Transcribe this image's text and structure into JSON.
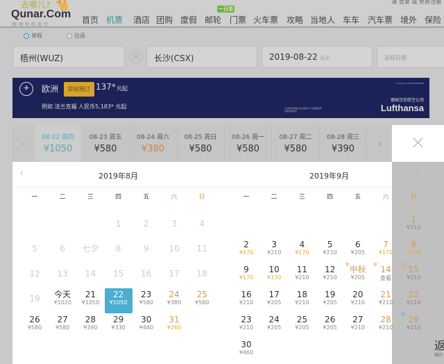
{
  "header": {
    "logo_cn": "去哪儿?",
    "logo": "Qunar.Com",
    "slogan": "聪明你的旅行",
    "top_links": "请 登录 或 免费注册",
    "nav": [
      "首页",
      "机票",
      "酒店",
      "团购",
      "度假",
      "邮轮",
      "门票",
      "火车票",
      "攻略",
      "当地人",
      "车车",
      "汽车票",
      "境外",
      "保险"
    ],
    "nav_active": 1,
    "nav_badge": "一日游"
  },
  "search": {
    "trip_types": [
      "单程",
      "往返"
    ],
    "from": "梧州(WUZ)",
    "swap": "换",
    "to": "长沙(CSX)",
    "date": "2019-08-22",
    "date_hint": "后天",
    "return_placeholder": "返程日期"
  },
  "banner": {
    "region": "欧洲",
    "book_label": "即刻预订",
    "price": "137*",
    "unit": "元起",
    "example": "例如 法兰克福 人民币5,183* 元起",
    "fine_print": "*包括所有税费及附加费用 不包括服务费和票务服务费",
    "alliance": "A STAR ALLIANCE MEMBER",
    "airline_cn": "德国汉莎航空公司",
    "airline": "Lufthansa"
  },
  "date_strip": [
    {
      "d": "08-22 周四",
      "p": "¥1050",
      "state": "active"
    },
    {
      "d": "08-23 周五",
      "p": "¥580"
    },
    {
      "d": "08-24 周六",
      "p": "¥380",
      "state": "low"
    },
    {
      "d": "08-25 周日",
      "p": "¥580"
    },
    {
      "d": "08-26 周一",
      "p": "¥580"
    },
    {
      "d": "08-27 周二",
      "p": "¥580"
    },
    {
      "d": "08-28 周三",
      "p": "¥390"
    }
  ],
  "weekdays": [
    "一",
    "二",
    "三",
    "四",
    "五",
    "六",
    "日"
  ],
  "calendar": [
    {
      "title": "2019年8月",
      "weeks": [
        [
          null,
          null,
          null,
          {
            "n": "1",
            "past": 1
          },
          {
            "n": "2",
            "past": 1
          },
          {
            "n": "3",
            "past": 1
          },
          {
            "n": "4",
            "past": 1
          }
        ],
        [
          {
            "n": "5",
            "past": 1
          },
          {
            "n": "6",
            "past": 1
          },
          {
            "n": "七夕",
            "past": 1
          },
          {
            "n": "8",
            "past": 1
          },
          {
            "n": "9",
            "past": 1
          },
          {
            "n": "10",
            "past": 1
          },
          {
            "n": "11",
            "past": 1
          }
        ],
        [
          {
            "n": "12",
            "past": 1
          },
          {
            "n": "13",
            "past": 1
          },
          {
            "n": "14",
            "past": 1
          },
          {
            "n": "15",
            "past": 1
          },
          {
            "n": "16",
            "past": 1
          },
          {
            "n": "17",
            "past": 1
          },
          {
            "n": "18",
            "past": 1
          }
        ],
        [
          {
            "n": "19",
            "past": 1
          },
          {
            "n": "今天",
            "p": "¥1020"
          },
          {
            "n": "21",
            "p": "¥1050"
          },
          {
            "n": "22",
            "p": "¥1050",
            "sel": 1
          },
          {
            "n": "23",
            "p": "¥580"
          },
          {
            "n": "24",
            "p": "¥380"
          },
          {
            "n": "25",
            "p": "¥580"
          }
        ],
        [
          {
            "n": "26",
            "p": "¥580"
          },
          {
            "n": "27",
            "p": "¥580"
          },
          {
            "n": "28",
            "p": "¥390"
          },
          {
            "n": "29",
            "p": "¥330"
          },
          {
            "n": "30",
            "p": "¥440"
          },
          {
            "n": "31",
            "p": "¥260",
            "low": 1
          },
          null
        ]
      ]
    },
    {
      "title": "2019年9月",
      "weeks": [
        [
          null,
          null,
          null,
          null,
          null,
          null,
          {
            "n": "1",
            "p": "¥210"
          }
        ],
        [
          {
            "n": "2",
            "p": "¥170",
            "low": 1
          },
          {
            "n": "3",
            "p": "¥210"
          },
          {
            "n": "4",
            "p": "¥170",
            "low": 1
          },
          {
            "n": "5",
            "p": "¥210"
          },
          {
            "n": "6",
            "p": "¥205"
          },
          {
            "n": "7",
            "p": "¥170",
            "low": 1
          },
          {
            "n": "8",
            "p": "¥170",
            "low": 1
          }
        ],
        [
          {
            "n": "9",
            "p": "¥170",
            "low": 1
          },
          {
            "n": "10",
            "p": "¥170",
            "low": 1
          },
          {
            "n": "11",
            "p": "¥210"
          },
          {
            "n": "12",
            "p": "¥210"
          },
          {
            "n": "中秋",
            "p": "¥205",
            "tag": "休",
            "hol": 1
          },
          {
            "n": "14",
            "p": "查看",
            "tag": "休"
          },
          {
            "n": "15",
            "p": "¥210",
            "tag": "休"
          }
        ],
        [
          {
            "n": "16",
            "p": "¥210"
          },
          {
            "n": "17",
            "p": "¥205"
          },
          {
            "n": "18",
            "p": "¥210"
          },
          {
            "n": "19",
            "p": "¥205"
          },
          {
            "n": "20",
            "p": "¥210"
          },
          {
            "n": "21",
            "p": "¥210"
          },
          {
            "n": "22",
            "p": "¥210"
          }
        ],
        [
          {
            "n": "23",
            "p": "¥210"
          },
          {
            "n": "24",
            "p": "¥205"
          },
          {
            "n": "25",
            "p": "¥205"
          },
          {
            "n": "26",
            "p": "¥205"
          },
          {
            "n": "27",
            "p": "¥210"
          },
          {
            "n": "28",
            "p": "¥210"
          },
          {
            "n": "29",
            "p": "¥210",
            "tag": "班",
            "work": 1
          }
        ],
        [
          {
            "n": "30",
            "p": "¥460"
          },
          null,
          null,
          null,
          null,
          null,
          null
        ]
      ]
    }
  ],
  "close_icon": "×",
  "side_text": "返",
  "side_sub": "国内"
}
